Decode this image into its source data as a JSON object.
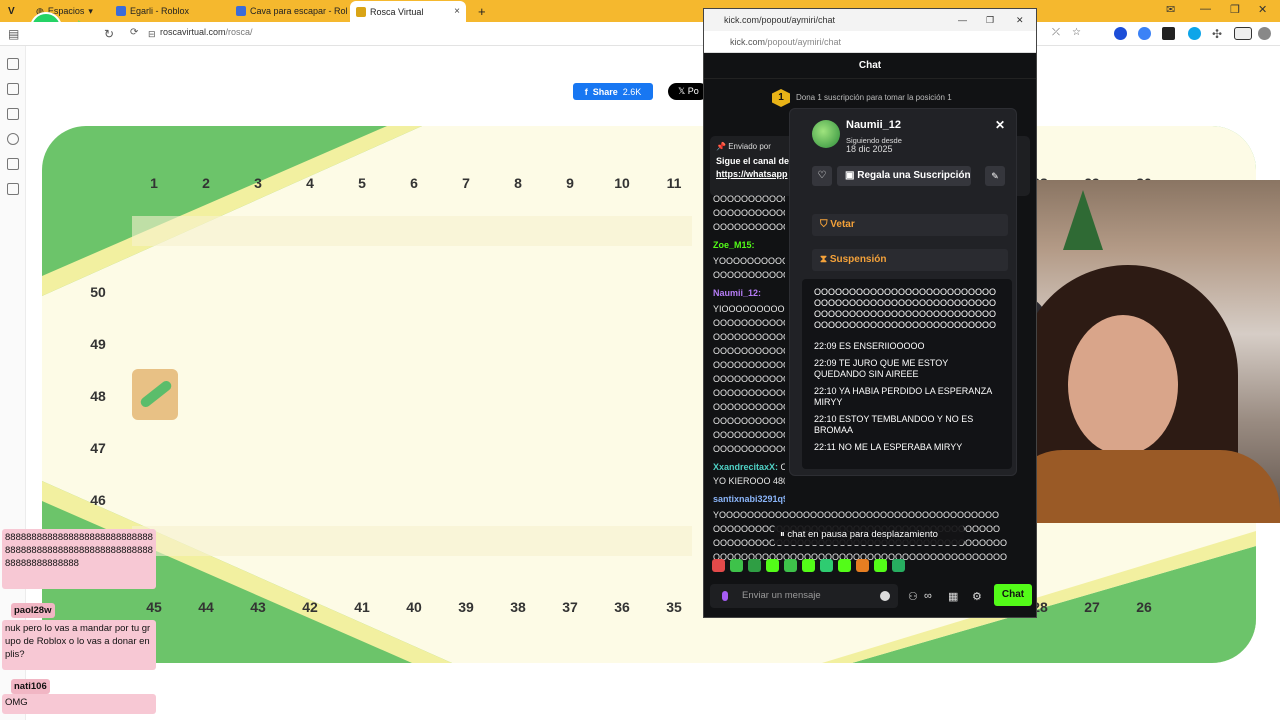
{
  "browser": {
    "tabs": [
      {
        "label": "Espacios"
      },
      {
        "label": "Egarli - Roblox"
      },
      {
        "label": "Cava para escapar - Rol"
      },
      {
        "label": "Rosca Virtual"
      }
    ],
    "url_domain": "roscavirtual.com",
    "url_path": "/rosca/",
    "new_tab": "+"
  },
  "page": {
    "share_label": "Share",
    "share_count": "2.6K",
    "post_label": "Po",
    "top_numbers": [
      "1",
      "2",
      "3",
      "4",
      "5",
      "6",
      "7",
      "8",
      "9",
      "10",
      "11"
    ],
    "right_top_numbers": [
      "28",
      "29",
      "30"
    ],
    "left_numbers": [
      "50",
      "49",
      "48",
      "47",
      "46"
    ],
    "bottom_numbers": [
      "45",
      "44",
      "43",
      "42",
      "41",
      "40",
      "39",
      "38",
      "37",
      "36",
      "35"
    ],
    "bottom_right_numbers": [
      "28",
      "27",
      "26"
    ]
  },
  "overlay": [
    {
      "type": "msg",
      "text": "8888888888888888888888888888888888888888888888888888888888888888888888"
    },
    {
      "type": "user",
      "text": "paol28w"
    },
    {
      "type": "msg",
      "text": "nuk pero lo vas a mandar por tu grupo de Roblox o lo vas a donar en plis?"
    },
    {
      "type": "user",
      "text": "nati106"
    },
    {
      "type": "msg",
      "text": "OMG"
    }
  ],
  "popup": {
    "window_title": "kick.com/popout/aymiri/chat",
    "url_domain": "kick.com",
    "url_path": "/popout/aymiri/chat",
    "header": "Chat",
    "pin_rank": "1",
    "pin_text": "Dona 1 suscripción para tomar la posición 1",
    "pinned_by": "Enviado por",
    "pinned_text": "Sigue el canal de",
    "pinned_link": "https://whatsapp",
    "lines": [
      {
        "user": "",
        "text": "OOOOOOOOOOOO",
        "color": "#e8e8e8"
      },
      {
        "user": "",
        "text": "OOOOOOOOOOOO",
        "color": "#e8e8e8"
      },
      {
        "user": "",
        "text": "OOOOOOOOOOOO",
        "color": "#e8e8e8"
      },
      {
        "user": "Zoe_M15:",
        "text": "",
        "color": "#53fc18"
      },
      {
        "user": "",
        "text": "YOOOOOOOOOOO",
        "color": "#e8e8e8"
      },
      {
        "user": "",
        "text": "OOOOOOOOOOOO",
        "color": "#e8e8e8"
      },
      {
        "user": "Naumii_12:",
        "text": "",
        "color": "#b57cf5"
      },
      {
        "user": "",
        "text": "YIOOOOOOOOOO",
        "color": "#e8e8e8"
      },
      {
        "user": "",
        "text": "OOOOOOOOOOOO",
        "color": "#e8e8e8"
      },
      {
        "user": "",
        "text": "OOOOOOOOOOOO",
        "color": "#e8e8e8"
      },
      {
        "user": "",
        "text": "OOOOOOOOOOOO",
        "color": "#e8e8e8"
      },
      {
        "user": "",
        "text": "OOOOOOOOOOOO",
        "color": "#e8e8e8"
      },
      {
        "user": "",
        "text": "OOOOOOOOOOOO",
        "color": "#e8e8e8"
      },
      {
        "user": "",
        "text": "OOOOOOOOOOOO",
        "color": "#e8e8e8"
      },
      {
        "user": "",
        "text": "OOOOOOOOOOOO",
        "color": "#e8e8e8"
      },
      {
        "user": "",
        "text": "OOOOOOOOOOOO",
        "color": "#e8e8e8"
      },
      {
        "user": "",
        "text": "OOOOOOOOOOOO",
        "color": "#e8e8e8"
      },
      {
        "user": "",
        "text": "OOOOOOOOOOOO",
        "color": "#e8e8e8"
      },
      {
        "user": "XxandrecitaxX:",
        "text": "Ol",
        "color": "#4fd1c5"
      },
      {
        "user": "",
        "text": "YO KIEROOO 480",
        "color": "#e8e8e8"
      },
      {
        "user": "santixnabi3291q920:",
        "text": "",
        "color": "#8ab4f8"
      },
      {
        "user": "",
        "text": "YOOOOOOOOOOOOOOOOOOOOOOOOOOOOOOOOOOOOOOOO",
        "color": "#e8e8e8"
      },
      {
        "user": "",
        "text": "OOOOOOOOOOOOOOOOOOOOOOOOOOOOOOOOOOOOOOOOO",
        "color": "#e8e8e8"
      },
      {
        "user": "",
        "text": "OOOOOOOOOOOOOOOOOOOOOOOOOOOOOOOOOOOOOOOOOO",
        "color": "#e8e8e8"
      },
      {
        "user": "",
        "text": "OOOOOOOOOOOOOOOOOOOOOOOOOOOOOOOOOOOOOOOOOO",
        "color": "#e8e8e8"
      }
    ],
    "paused_label": "chat en pausa para desplazamiento",
    "input_placeholder": "Enviar un mensaje",
    "send_label": "Chat",
    "emote_colors": [
      "#e34a4a",
      "#3ec24a",
      "#2f9e44",
      "#53fc18",
      "#3ec24a",
      "#53fc18",
      "#2ecc71",
      "#53fc18",
      "#e67e22",
      "#53fc18",
      "#27ae60"
    ],
    "accent": "#53fc18"
  },
  "usercard": {
    "name": "Naumii_12",
    "following_label": "Siguiendo desde",
    "following_date": "18 dic 2025",
    "gift_label": "Regala una Suscripción",
    "veto_label": "Vetar",
    "suspend_label": "Suspensión",
    "history": [
      "OOOOOOOOOOOOOOOOOOOOOOOOOOOOOOOOOOOOOOOOOOOOOOOOOOOOOOOOOOOOOOOOOOOOOOOOOOOOOOOOOOOOOOOOOOOOOOOOOOOOOOOO",
      "22:09 ES ENSERIIOOOOO",
      "22:09 TE JURO QUE ME ESTOY QUEDANDO SIN AIREEE",
      "22:10 YA HABIA PERDIDO LA ESPERANZA MIRYY",
      "22:10 ESTOY TEMBLANDOO Y NO ES BROMAA",
      "22:11 NO ME LA ESPERABA MIRYY"
    ]
  }
}
